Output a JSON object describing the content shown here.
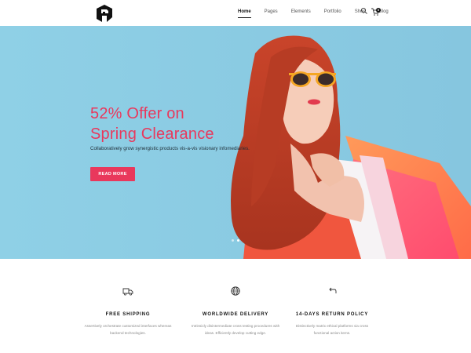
{
  "nav": {
    "items": [
      {
        "label": "Home",
        "active": true
      },
      {
        "label": "Pages",
        "active": false
      },
      {
        "label": "Elements",
        "active": false
      },
      {
        "label": "Portfolio",
        "active": false
      },
      {
        "label": "Shop",
        "active": false
      },
      {
        "label": "Blog",
        "active": false
      }
    ],
    "cart_count": "0",
    "icons": [
      "logo-icon",
      "search-icon",
      "cart-icon"
    ]
  },
  "hero": {
    "headline_line1": "52% Offer on",
    "headline_line2": "Spring Clearance",
    "subtext": "Collaboratively grow synergistic products vis-a-vis visionary infomediaries.",
    "cta_label": "READ MORE",
    "slides": 2,
    "active_slide": 2,
    "accent_color": "#e9385c",
    "background_color": "#8fcde4"
  },
  "features": [
    {
      "icon": "truck-icon",
      "title": "FREE SHIPPING",
      "line1": "Assertively orchestrate customized interfaces whereas",
      "line2": "backend technologies."
    },
    {
      "icon": "globe-icon",
      "title": "WORLDWIDE DELIVERY",
      "line1": "Intrinsicly disintermediate cross testing procedures with",
      "line2": "ideas. Efficiently develop cutting edge."
    },
    {
      "icon": "return-arrow-icon",
      "title": "14-DAYS RETURN POLICY",
      "line1": "Distinctively matrix ethical platforms via cross",
      "line2": "functional action items."
    }
  ]
}
